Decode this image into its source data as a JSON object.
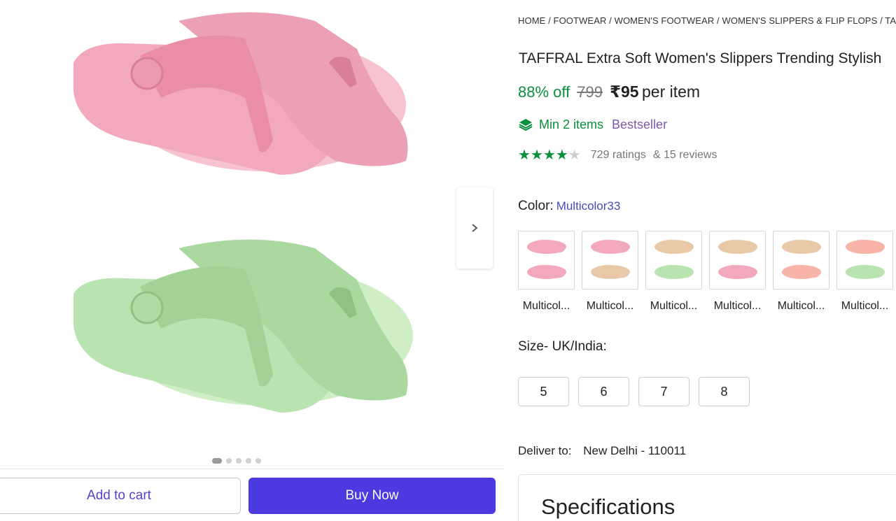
{
  "gallery": {
    "dots_total": 5,
    "dots_active_index": 0,
    "colors": {
      "pink": "#f3a9bd",
      "pink_dark": "#e98ea5",
      "green": "#b9e3b0",
      "green_dark": "#a3d296"
    }
  },
  "actions": {
    "add_to_cart": "Add to cart",
    "buy_now": "Buy Now"
  },
  "breadcrumb": [
    "HOME",
    "FOOTWEAR",
    "WOMEN'S FOOTWEAR",
    "WOMEN'S SLIPPERS & FLIP FLOPS",
    "TAFF"
  ],
  "product": {
    "title": "TAFFRAL Extra Soft Women's Slippers Trending Stylish",
    "discount": "88% off",
    "mrp": "799",
    "price": "₹95",
    "price_suffix": "per item",
    "min_items": "Min 2 items",
    "bestseller": "Bestseller",
    "rating_stars": 4,
    "ratings": "729 ratings",
    "reviews": "& 15 reviews"
  },
  "color": {
    "label": "Color:",
    "value": "Multicolor33",
    "options": [
      {
        "label": "Multicol...",
        "top": "#f3a9bd",
        "bottom": "#f3a9bd"
      },
      {
        "label": "Multicol...",
        "top": "#f3a9bd",
        "bottom": "#e8c9a7"
      },
      {
        "label": "Multicol...",
        "top": "#e8c9a7",
        "bottom": "#b9e3b0"
      },
      {
        "label": "Multicol...",
        "top": "#e8c9a7",
        "bottom": "#f3a9bd"
      },
      {
        "label": "Multicol...",
        "top": "#e8c9a7",
        "bottom": "#f7b4a8"
      },
      {
        "label": "Multicol...",
        "top": "#f7b4a8",
        "bottom": "#b9e3b0"
      }
    ]
  },
  "size": {
    "label": "Size- UK/India:",
    "options": [
      "5",
      "6",
      "7",
      "8"
    ]
  },
  "delivery": {
    "label": "Deliver to:",
    "location": "New Delhi - 110011"
  },
  "specifications": {
    "title": "Specifications"
  }
}
